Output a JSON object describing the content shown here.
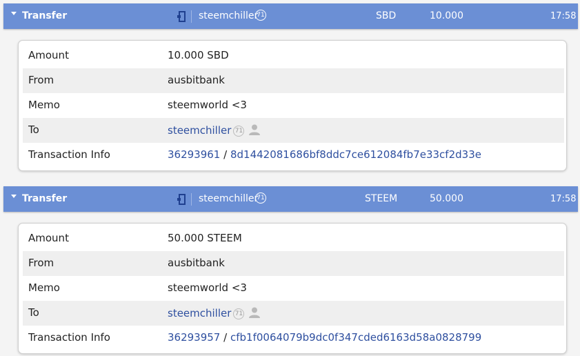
{
  "transfers": [
    {
      "header": {
        "title": "Transfer",
        "user": "steemchiller",
        "rep": "71",
        "currency": "SBD",
        "amount": "10.000",
        "time": "17:58"
      },
      "details": {
        "amount_label": "Amount",
        "amount_value": "10.000 SBD",
        "from_label": "From",
        "from_value": "ausbitbank",
        "memo_label": "Memo",
        "memo_value": "steemworld <3",
        "to_label": "To",
        "to_value": "steemchiller",
        "to_rep": "71",
        "tx_label": "Transaction Info",
        "tx_block": "36293961",
        "tx_sep": "/",
        "tx_hash": "8d1442081686bf8ddc7ce612084fb7e33cf2d33e"
      }
    },
    {
      "header": {
        "title": "Transfer",
        "user": "steemchiller",
        "rep": "71",
        "currency": "STEEM",
        "amount": "50.000",
        "time": "17:58"
      },
      "details": {
        "amount_label": "Amount",
        "amount_value": "50.000 STEEM",
        "from_label": "From",
        "from_value": "ausbitbank",
        "memo_label": "Memo",
        "memo_value": "steemworld <3",
        "to_label": "To",
        "to_value": "steemchiller",
        "to_rep": "71",
        "tx_label": "Transaction Info",
        "tx_block": "36293957",
        "tx_sep": "/",
        "tx_hash": "cfb1f0064079b9dc0f347cded6163d58a0828799"
      }
    }
  ],
  "icons": {
    "expand": "chevron-down-icon",
    "direction": "incoming-transfer-icon",
    "profile": "person-icon"
  },
  "colors": {
    "header_bar": "#6b8fd5",
    "link": "#2e4f9f",
    "row_alt": "#efefef"
  }
}
